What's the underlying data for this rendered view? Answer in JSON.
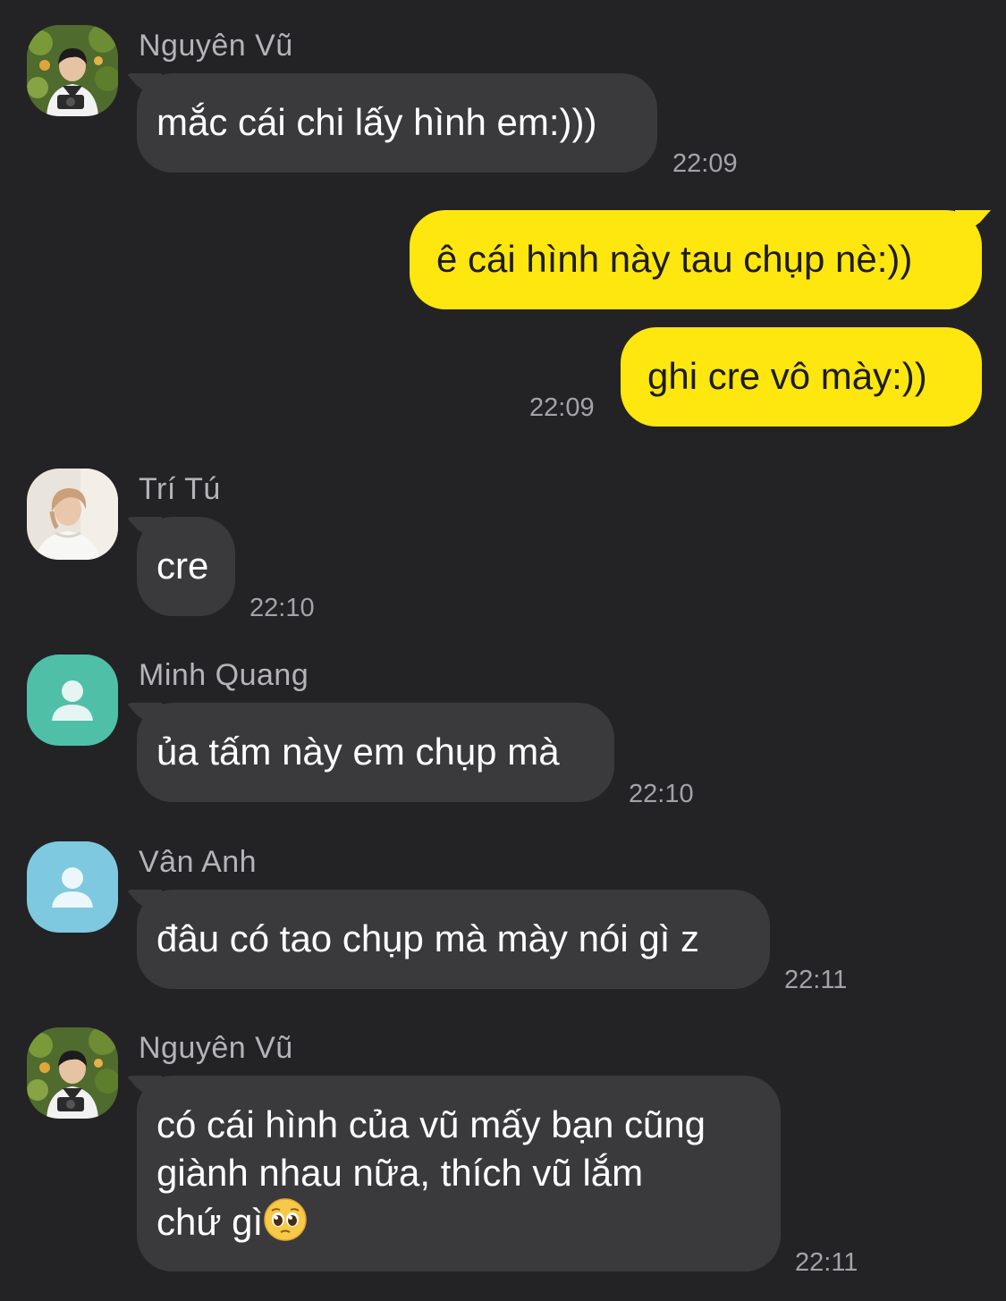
{
  "messages": [
    {
      "sender": "Nguyên Vũ",
      "text": "mắc cái chi lấy hình em:)))",
      "time": "22:09"
    },
    {
      "text": "ê cái hình này tau chụp nè:))"
    },
    {
      "text": "ghi cre vô mày:))",
      "time": "22:09"
    },
    {
      "sender": "Trí Tú",
      "text": "cre",
      "time": "22:10"
    },
    {
      "sender": "Minh Quang",
      "text": "ủa tấm này em chụp mà",
      "time": "22:10"
    },
    {
      "sender": "Vân Anh",
      "text": "đâu có tao chụp mà mày nói gì z",
      "time": "22:11"
    },
    {
      "sender": "Nguyên Vũ",
      "lines": [
        "có cái hình của vũ mấy bạn cũng",
        "giành nhau nữa, thích vũ lắm",
        "chứ gì"
      ],
      "emoji": "pleading-face",
      "time": "22:11"
    }
  ],
  "colors": {
    "background": "#232325",
    "incoming_bubble": "#3a3a3d",
    "outgoing_bubble": "#fee60f",
    "avatar_teal": "#4fbfa8",
    "avatar_lightblue": "#7ec9e0"
  }
}
